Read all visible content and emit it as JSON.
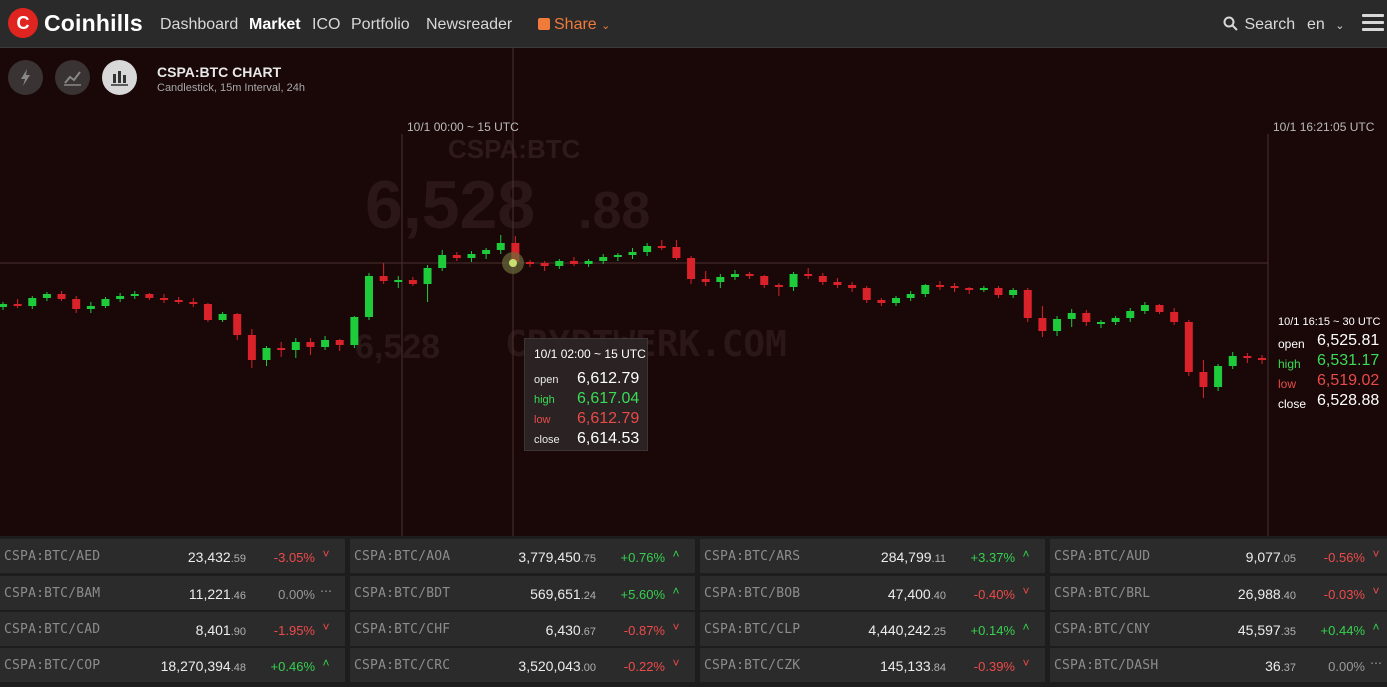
{
  "nav": {
    "logo_letter": "C",
    "logo_text": "Coinhills",
    "items": [
      "Dashboard",
      "Market",
      "ICO",
      "Portfolio",
      "Newsreader"
    ],
    "active": "Market",
    "share": "Share",
    "search": "Search",
    "lang": "en"
  },
  "chart": {
    "title": "CSPA:BTC CHART",
    "subtitle": "Candlestick, 15m Interval, 24h",
    "crosshair_label": "10/1 00:00 ~ 15 UTC",
    "now_label": "10/1 16:21:05 UTC",
    "watermark_price": "6,528",
    "watermark_dec": ".88",
    "watermark_small": "6,528",
    "watermark_site": "CRYPTWERK.COM",
    "watermark_label": "CSPA:BTC",
    "colors": {
      "up": "#1ecb3a",
      "down": "#d9222a",
      "bg": "#1a0808"
    },
    "tooltip": {
      "title": "10/1 02:00 ~ 15 UTC",
      "labels": {
        "open": "open",
        "high": "high",
        "low": "low",
        "close": "close"
      },
      "open": "6,612.79",
      "high": "6,617.04",
      "low": "6,612.79",
      "close": "6,614.53"
    },
    "last": {
      "title": "10/1 16:15 ~ 30 UTC",
      "labels": {
        "open": "open",
        "high": "high",
        "low": "low",
        "close": "close"
      },
      "open": "6,525.81",
      "high": "6,531.17",
      "low": "6,519.02",
      "close": "6,528.88"
    },
    "candles": [
      [
        6581,
        6586,
        6578,
        6584
      ],
      [
        6584,
        6589,
        6580,
        6582
      ],
      [
        6582,
        6592,
        6579,
        6590
      ],
      [
        6590,
        6596,
        6587,
        6594
      ],
      [
        6594,
        6597,
        6587,
        6589
      ],
      [
        6589,
        6592,
        6575,
        6579
      ],
      [
        6579,
        6586,
        6575,
        6582
      ],
      [
        6582,
        6591,
        6580,
        6589
      ],
      [
        6589,
        6595,
        6586,
        6592
      ],
      [
        6592,
        6597,
        6589,
        6594
      ],
      [
        6594,
        6595,
        6588,
        6590
      ],
      [
        6590,
        6594,
        6585,
        6588
      ],
      [
        6588,
        6591,
        6584,
        6586
      ],
      [
        6586,
        6590,
        6581,
        6584
      ],
      [
        6584,
        6585,
        6566,
        6568
      ],
      [
        6568,
        6576,
        6566,
        6574
      ],
      [
        6574,
        6575,
        6548,
        6553
      ],
      [
        6553,
        6559,
        6520,
        6528
      ],
      [
        6528,
        6542,
        6522,
        6540
      ],
      [
        6540,
        6546,
        6531,
        6538
      ],
      [
        6538,
        6550,
        6530,
        6546
      ],
      [
        6546,
        6550,
        6533,
        6541
      ],
      [
        6541,
        6552,
        6538,
        6548
      ],
      [
        6548,
        6549,
        6537,
        6543
      ],
      [
        6543,
        6572,
        6540,
        6571
      ],
      [
        6571,
        6615,
        6568,
        6612
      ],
      [
        6612,
        6625,
        6604,
        6607
      ],
      [
        6607,
        6612,
        6600,
        6608
      ],
      [
        6608,
        6611,
        6602,
        6604
      ],
      [
        6604,
        6623,
        6586,
        6620
      ],
      [
        6620,
        6638,
        6617,
        6633
      ],
      [
        6633,
        6636,
        6627,
        6630
      ],
      [
        6630,
        6637,
        6626,
        6634
      ],
      [
        6634,
        6640,
        6629,
        6638
      ],
      [
        6638,
        6653,
        6634,
        6645
      ],
      [
        6645,
        6652,
        6620,
        6626
      ],
      [
        6626,
        6628,
        6621,
        6625
      ],
      [
        6625,
        6627,
        6617,
        6622
      ],
      [
        6622,
        6629,
        6619,
        6627
      ],
      [
        6627,
        6631,
        6622,
        6624
      ],
      [
        6624,
        6629,
        6621,
        6627
      ],
      [
        6627,
        6634,
        6624,
        6631
      ],
      [
        6631,
        6635,
        6627,
        6633
      ],
      [
        6633,
        6640,
        6629,
        6636
      ],
      [
        6636,
        6645,
        6632,
        6642
      ],
      [
        6642,
        6648,
        6638,
        6641
      ],
      [
        6641,
        6648,
        6628,
        6630
      ],
      [
        6630,
        6632,
        6604,
        6609
      ],
      [
        6609,
        6617,
        6602,
        6606
      ],
      [
        6606,
        6614,
        6600,
        6611
      ],
      [
        6611,
        6618,
        6608,
        6614
      ],
      [
        6614,
        6616,
        6609,
        6612
      ],
      [
        6612,
        6613,
        6600,
        6603
      ],
      [
        6603,
        6605,
        6592,
        6601
      ],
      [
        6601,
        6616,
        6597,
        6614
      ],
      [
        6614,
        6620,
        6609,
        6612
      ],
      [
        6612,
        6615,
        6603,
        6606
      ],
      [
        6606,
        6610,
        6600,
        6603
      ],
      [
        6603,
        6606,
        6596,
        6600
      ],
      [
        6600,
        6602,
        6585,
        6588
      ],
      [
        6588,
        6590,
        6582,
        6585
      ],
      [
        6585,
        6592,
        6582,
        6590
      ],
      [
        6590,
        6597,
        6587,
        6594
      ],
      [
        6594,
        6604,
        6591,
        6603
      ],
      [
        6603,
        6607,
        6598,
        6602
      ],
      [
        6602,
        6605,
        6596,
        6600
      ],
      [
        6600,
        6601,
        6594,
        6598
      ],
      [
        6598,
        6602,
        6596,
        6600
      ],
      [
        6600,
        6602,
        6590,
        6593
      ],
      [
        6593,
        6600,
        6590,
        6598
      ],
      [
        6598,
        6600,
        6566,
        6570
      ],
      [
        6570,
        6582,
        6551,
        6557
      ],
      [
        6557,
        6572,
        6552,
        6569
      ],
      [
        6569,
        6579,
        6561,
        6575
      ],
      [
        6575,
        6578,
        6562,
        6566
      ],
      [
        6566,
        6568,
        6560,
        6566
      ],
      [
        6566,
        6572,
        6563,
        6570
      ],
      [
        6570,
        6580,
        6566,
        6577
      ],
      [
        6577,
        6586,
        6574,
        6583
      ],
      [
        6583,
        6584,
        6574,
        6576
      ],
      [
        6576,
        6580,
        6563,
        6566
      ],
      [
        6566,
        6568,
        6512,
        6516
      ],
      [
        6516,
        6528,
        6490,
        6501
      ],
      [
        6501,
        6524,
        6497,
        6522
      ],
      [
        6522,
        6536,
        6519,
        6532
      ],
      [
        6532,
        6535,
        6525,
        6530
      ],
      [
        6530,
        6533,
        6524,
        6528
      ]
    ]
  },
  "tickers": [
    [
      {
        "pair": "CSPA:BTC/AED",
        "int": "23,432",
        "dec": ".59",
        "chg": "-3.05%",
        "dir": "down"
      },
      {
        "pair": "CSPA:BTC/AOA",
        "int": "3,779,450",
        "dec": ".75",
        "chg": "+0.76%",
        "dir": "up"
      },
      {
        "pair": "CSPA:BTC/ARS",
        "int": "284,799",
        "dec": ".11",
        "chg": "+3.37%",
        "dir": "up"
      },
      {
        "pair": "CSPA:BTC/AUD",
        "int": "9,077",
        "dec": ".05",
        "chg": "-0.56%",
        "dir": "down"
      }
    ],
    [
      {
        "pair": "CSPA:BTC/BAM",
        "int": "11,221",
        "dec": ".46",
        "chg": "0.00%",
        "dir": "flat"
      },
      {
        "pair": "CSPA:BTC/BDT",
        "int": "569,651",
        "dec": ".24",
        "chg": "+5.60%",
        "dir": "up"
      },
      {
        "pair": "CSPA:BTC/BOB",
        "int": "47,400",
        "dec": ".40",
        "chg": "-0.40%",
        "dir": "down"
      },
      {
        "pair": "CSPA:BTC/BRL",
        "int": "26,988",
        "dec": ".40",
        "chg": "-0.03%",
        "dir": "down"
      }
    ],
    [
      {
        "pair": "CSPA:BTC/CAD",
        "int": "8,401",
        "dec": ".90",
        "chg": "-1.95%",
        "dir": "down"
      },
      {
        "pair": "CSPA:BTC/CHF",
        "int": "6,430",
        "dec": ".67",
        "chg": "-0.87%",
        "dir": "down"
      },
      {
        "pair": "CSPA:BTC/CLP",
        "int": "4,440,242",
        "dec": ".25",
        "chg": "+0.14%",
        "dir": "up"
      },
      {
        "pair": "CSPA:BTC/CNY",
        "int": "45,597",
        "dec": ".35",
        "chg": "+0.44%",
        "dir": "up"
      }
    ],
    [
      {
        "pair": "CSPA:BTC/COP",
        "int": "18,270,394",
        "dec": ".48",
        "chg": "+0.46%",
        "dir": "up"
      },
      {
        "pair": "CSPA:BTC/CRC",
        "int": "3,520,043",
        "dec": ".00",
        "chg": "-0.22%",
        "dir": "down"
      },
      {
        "pair": "CSPA:BTC/CZK",
        "int": "145,133",
        "dec": ".84",
        "chg": "-0.39%",
        "dir": "down"
      },
      {
        "pair": "CSPA:BTC/DASH",
        "int": "36",
        "dec": ".37",
        "chg": "0.00%",
        "dir": "flat"
      }
    ]
  ]
}
